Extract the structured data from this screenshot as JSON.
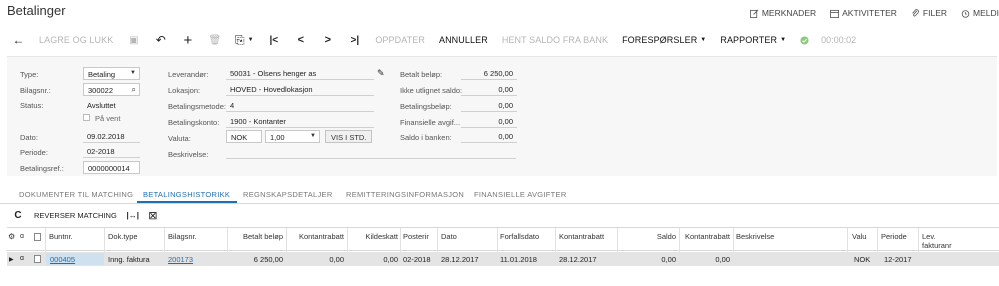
{
  "window": {
    "title": "Betalinger"
  },
  "top_links": [
    {
      "label": "MERKNADER",
      "icon": "note-edit-icon"
    },
    {
      "label": "AKTIVITETER",
      "icon": "calendar-icon"
    },
    {
      "label": "FILER",
      "icon": "paperclip-icon"
    },
    {
      "label": "MELDI",
      "icon": "alarm-clock-icon"
    }
  ],
  "toolbar": {
    "back_icon": "←",
    "save_close_label": "LAGRE OG LUKK",
    "save_icon": "▣",
    "undo_icon": "↶",
    "add_icon": "+",
    "delete_icon": "🗑",
    "clipboard_icon": "⎘",
    "first_icon": "|<",
    "prev_icon": "<",
    "next_icon": ">",
    "last_icon": ">|",
    "update_label": "OPPDATER",
    "cancel_label": "ANNULLER",
    "fetch_balance_label": "HENT SALDO FRA BANK",
    "inquiries_label": "FORESPØRSLER",
    "reports_label": "RAPPORTER",
    "timer": "00:00:02"
  },
  "form": {
    "type_label": "Type:",
    "type_value": "Betaling",
    "doc_no_label": "Bilagsnr.:",
    "doc_no_value": "300022",
    "status_label": "Status:",
    "status_value": "Avsluttet",
    "on_hold_label": "På vent",
    "date_label": "Dato:",
    "date_value": "09.02.2018",
    "period_label": "Periode:",
    "period_value": "02-2018",
    "ref_label": "Betalingsref.:",
    "ref_value": "0000000014",
    "vendor_label": "Leverandør:",
    "vendor_value": "50031 - Olsens henger as",
    "location_label": "Lokasjon:",
    "location_value": "HOVED - Hovedlokasjon",
    "method_label": "Betalingsmetode:",
    "method_value": "4",
    "account_label": "Betalingskonto:",
    "account_value": "1900 - Kontanter",
    "currency_label": "Valuta:",
    "currency_value": "NOK",
    "rate_value": "1,00",
    "view_std_label": "VIS I STD.",
    "description_label": "Beskrivelse:",
    "paid_amount_label": "Betalt beløp:",
    "paid_amount_value": "6 250,00",
    "unapplied_label": "Ikke utlignet saldo:",
    "unapplied_value": "0,00",
    "payment_amount_label": "Betalingsbeløp:",
    "payment_amount_value": "0,00",
    "fin_charges_label": "Finansielle avgif...",
    "fin_charges_value": "0,00",
    "bank_balance_label": "Saldo i banken:",
    "bank_balance_value": "0,00"
  },
  "tabs": [
    "DOKUMENTER TIL MATCHING",
    "BETALINGSHISTORIKK",
    "REGNSKAPSDETALJER",
    "REMITTERINGSINFORMASJON",
    "FINANSIELLE AVGIFTER"
  ],
  "active_tab": "BETALINGSHISTORIKK",
  "grid_toolbar": {
    "refresh_icon": "C",
    "reverse_label": "REVERSER MATCHING",
    "fit_icon": "|↔|",
    "excel_icon": "⊠"
  },
  "grid": {
    "columns": {
      "batch": "Buntnr.",
      "doc_type": "Dok.type",
      "ref_no": "Bilagsnr.",
      "paid": "Betalt beløp",
      "cash_discount": "Kontantrabatt",
      "withholding": "Kildeskatt",
      "post_period": "Posterir",
      "date": "Dato",
      "due_date": "Forfallsdato",
      "cash_discount_date": "Kontantrabatt",
      "balance": "Saldo",
      "cash_discount2": "Kontantrabatt",
      "description": "Beskrivelse",
      "currency": "Valu",
      "period": "Periode",
      "vendor_invoice_1": "Lev.",
      "vendor_invoice_2": "fakturanr"
    },
    "rows": [
      {
        "batch": "000405",
        "doc_type": "Inng. faktura",
        "ref_no": "200173",
        "paid": "6 250,00",
        "cash_discount": "0,00",
        "withholding": "0,00",
        "post_period": "02-2018",
        "date": "28.12.2017",
        "due_date": "11.01.2018",
        "cash_discount_date": "28.12.2017",
        "balance": "0,00",
        "cash_discount2": "0,00",
        "description": "",
        "currency": "NOK",
        "period": "12-2017",
        "vendor_invoice": ""
      }
    ]
  }
}
